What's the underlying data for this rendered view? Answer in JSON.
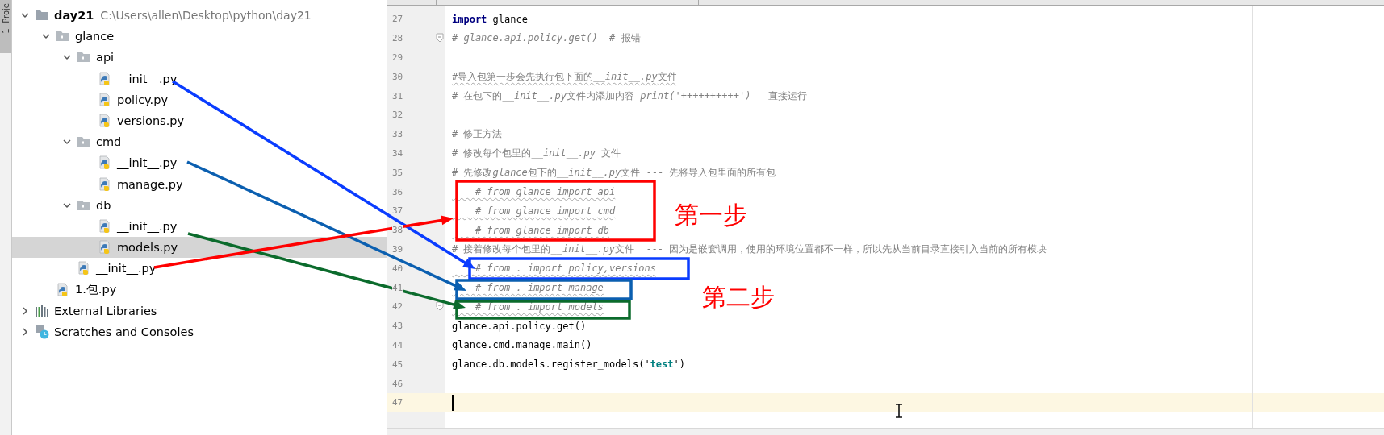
{
  "side_tab": {
    "label": "1: Proje",
    "selected": true
  },
  "tree": [
    {
      "label": "day21",
      "path": "C:\\Users\\allen\\Desktop\\python\\day21",
      "kind": "project",
      "expanded": true,
      "selected": false,
      "children": [
        {
          "label": "glance",
          "kind": "package",
          "expanded": true,
          "selected": false,
          "children": [
            {
              "label": "api",
              "kind": "package",
              "expanded": true,
              "selected": false,
              "children": [
                {
                  "label": "__init__.py",
                  "kind": "python",
                  "selected": false
                },
                {
                  "label": "policy.py",
                  "kind": "python",
                  "selected": false
                },
                {
                  "label": "versions.py",
                  "kind": "python",
                  "selected": false
                }
              ]
            },
            {
              "label": "cmd",
              "kind": "package",
              "expanded": true,
              "selected": false,
              "children": [
                {
                  "label": "__init__.py",
                  "kind": "python",
                  "selected": false
                },
                {
                  "label": "manage.py",
                  "kind": "python",
                  "selected": false
                }
              ]
            },
            {
              "label": "db",
              "kind": "package",
              "expanded": true,
              "selected": false,
              "children": [
                {
                  "label": "__init__.py",
                  "kind": "python",
                  "selected": false
                },
                {
                  "label": "models.py",
                  "kind": "python",
                  "selected": true
                }
              ]
            },
            {
              "label": "__init__.py",
              "kind": "python",
              "selected": false
            }
          ]
        },
        {
          "label": "1.包.py",
          "kind": "python",
          "selected": false
        }
      ]
    },
    {
      "label": "External Libraries",
      "kind": "libraries",
      "expanded": false,
      "selected": false
    },
    {
      "label": "Scratches and Consoles",
      "kind": "scratches",
      "expanded": false,
      "selected": false
    }
  ],
  "code": [
    {
      "n": "27",
      "fold": false,
      "squiggly": false,
      "current": false,
      "tokens": [
        {
          "kind": "keyword",
          "text": "import"
        },
        {
          "kind": "plain",
          "text": " glance"
        }
      ]
    },
    {
      "n": "28",
      "fold": true,
      "squiggly": false,
      "current": false,
      "tokens": [
        {
          "kind": "comment",
          "text": "# glance.api.policy.get()  # "
        },
        {
          "kind": "note",
          "text": "报错"
        }
      ]
    },
    {
      "n": "29",
      "fold": false,
      "current": false
    },
    {
      "n": "30",
      "fold": false,
      "squiggly": true,
      "current": false,
      "tokens": [
        {
          "kind": "note",
          "text": "#导入包第一步会先执行包下面的"
        },
        {
          "kind": "comment",
          "text": "__init__.py"
        },
        {
          "kind": "note",
          "text": "文件"
        }
      ]
    },
    {
      "n": "31",
      "fold": false,
      "squiggly": false,
      "current": false,
      "tokens": [
        {
          "kind": "note",
          "text": "# 在包下的"
        },
        {
          "kind": "comment",
          "text": "__init__.py"
        },
        {
          "kind": "note",
          "text": "文件内添加内容 "
        },
        {
          "kind": "comment",
          "text": "print('++++++++++')"
        },
        {
          "kind": "note",
          "text": "   直接运行"
        }
      ]
    },
    {
      "n": "32",
      "fold": false,
      "current": false
    },
    {
      "n": "33",
      "fold": false,
      "squiggly": false,
      "current": false,
      "tokens": [
        {
          "kind": "note",
          "text": "# 修正方法"
        }
      ]
    },
    {
      "n": "34",
      "fold": false,
      "squiggly": false,
      "current": false,
      "tokens": [
        {
          "kind": "note",
          "text": "# 修改每个包里的"
        },
        {
          "kind": "comment",
          "text": "__init__.py "
        },
        {
          "kind": "note",
          "text": "文件"
        }
      ]
    },
    {
      "n": "35",
      "fold": false,
      "squiggly": false,
      "current": false,
      "tokens": [
        {
          "kind": "note",
          "text": "# 先修改"
        },
        {
          "kind": "comment",
          "text": "glance"
        },
        {
          "kind": "note",
          "text": "包下的"
        },
        {
          "kind": "comment",
          "text": "__init__.py"
        },
        {
          "kind": "note",
          "text": "文件 --- 先将导入包里面的所有包"
        }
      ]
    },
    {
      "n": "36",
      "fold": false,
      "squiggly": true,
      "current": false,
      "tokens": [
        {
          "kind": "comment",
          "text": "    # from glance import api"
        }
      ]
    },
    {
      "n": "37",
      "fold": false,
      "squiggly": true,
      "current": false,
      "tokens": [
        {
          "kind": "comment",
          "text": "    # from glance import cmd"
        }
      ]
    },
    {
      "n": "38",
      "fold": false,
      "squiggly": true,
      "current": false,
      "tokens": [
        {
          "kind": "comment",
          "text": "    # from glance import db"
        }
      ]
    },
    {
      "n": "39",
      "fold": false,
      "squiggly": false,
      "current": false,
      "tokens": [
        {
          "kind": "note",
          "text": "# 接着修改每个包里的"
        },
        {
          "kind": "comment",
          "text": "__init__.py"
        },
        {
          "kind": "note",
          "text": "文件  --- 因为是嵌套调用，使用的环境位置都不一样，所以先从当前目录直接引入当前的所有模块"
        }
      ]
    },
    {
      "n": "40",
      "fold": false,
      "squiggly": true,
      "current": false,
      "tokens": [
        {
          "kind": "comment",
          "text": "    # from . import policy,versions"
        }
      ]
    },
    {
      "n": "41",
      "fold": false,
      "squiggly": true,
      "current": false,
      "tokens": [
        {
          "kind": "comment",
          "text": "    # from . import manage"
        }
      ]
    },
    {
      "n": "42",
      "fold": true,
      "squiggly": true,
      "current": false,
      "tokens": [
        {
          "kind": "comment",
          "text": "    # from . import models"
        }
      ]
    },
    {
      "n": "43",
      "fold": false,
      "squiggly": false,
      "current": false,
      "tokens": [
        {
          "kind": "plain",
          "text": "glance.api.policy.get()"
        }
      ]
    },
    {
      "n": "44",
      "fold": false,
      "squiggly": false,
      "current": false,
      "tokens": [
        {
          "kind": "plain",
          "text": "glance.cmd.manage.main()"
        }
      ]
    },
    {
      "n": "45",
      "fold": false,
      "squiggly": false,
      "current": false,
      "tokens": [
        {
          "kind": "plain",
          "text": "glance.db.models.register_models('"
        },
        {
          "kind": "string",
          "text": "test"
        },
        {
          "kind": "plain",
          "text": "')"
        }
      ]
    },
    {
      "n": "46",
      "fold": false,
      "current": false
    },
    {
      "n": "47",
      "fold": false,
      "current": true
    }
  ],
  "annotations": {
    "boxes": [
      {
        "color": "#ff0000"
      },
      {
        "color": "#0a3cff"
      },
      {
        "color": "#0b5fb0"
      },
      {
        "color": "#0b6b2c"
      }
    ],
    "arrows": [
      {
        "color": "#0a3cff"
      },
      {
        "color": "#0b5fb0"
      },
      {
        "color": "#0b6b2c"
      },
      {
        "color": "#ff0000"
      }
    ],
    "labels": [
      {
        "text": "第一步",
        "color": "#ff0000"
      },
      {
        "text": "第二步",
        "color": "#ff0000"
      }
    ]
  }
}
